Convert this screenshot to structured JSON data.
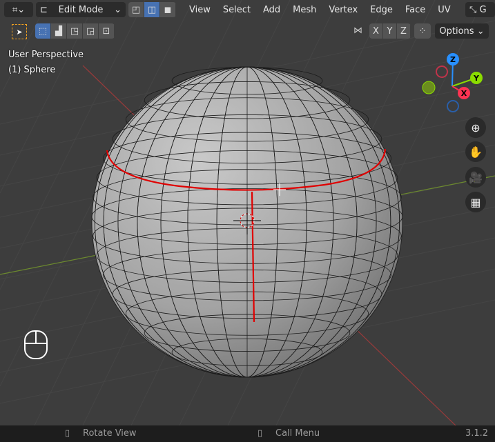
{
  "header": {
    "mode": "Edit Mode",
    "menus": [
      "View",
      "Select",
      "Add",
      "Mesh",
      "Vertex",
      "Edge",
      "Face",
      "UV"
    ],
    "transform_label": "G"
  },
  "toolbar": {
    "axes": [
      "X",
      "Y",
      "Z"
    ],
    "options": "Options"
  },
  "overlay": {
    "view_name": "User Perspective",
    "object": "(1) Sphere"
  },
  "gizmo": {
    "z": "Z",
    "y": "Y",
    "x": "X"
  },
  "status": {
    "rotate": "Rotate View",
    "call_menu": "Call Menu",
    "version": "3.1.2"
  },
  "colors": {
    "accent": "#4772b3",
    "x_axis": "#ff3352",
    "y_axis": "#8bdc00",
    "z_axis": "#2890ff",
    "seam": "#e00000"
  }
}
